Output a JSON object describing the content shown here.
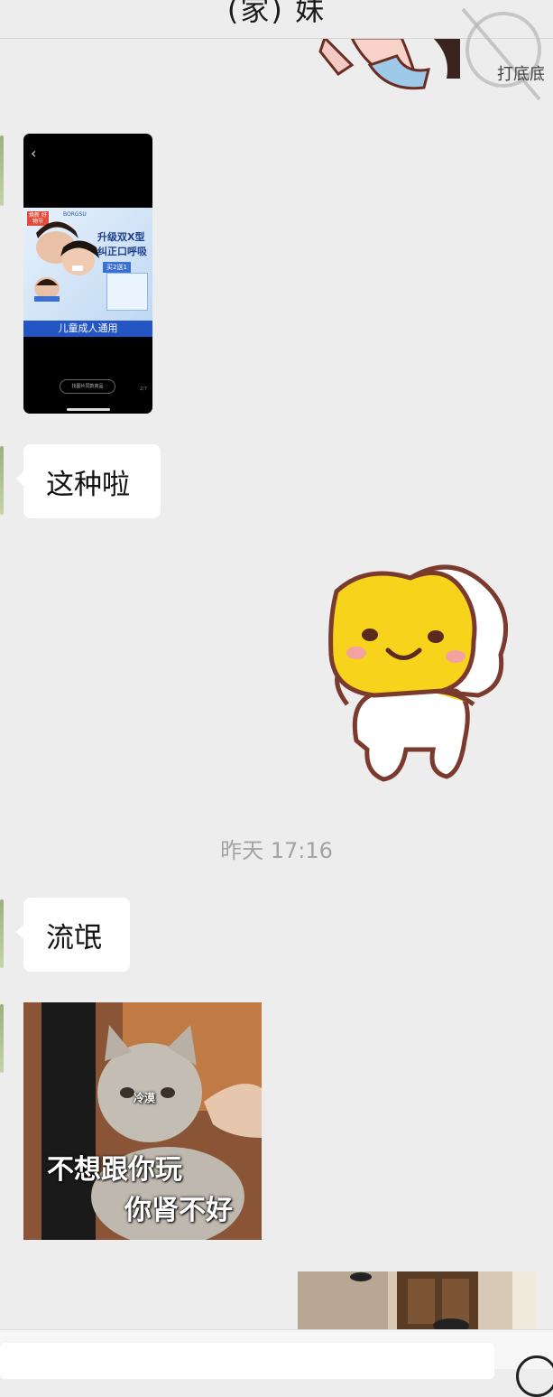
{
  "header": {
    "title": "(家) 妹"
  },
  "watermark": {
    "text": "打底底"
  },
  "phone_screenshot": {
    "back_glyph": "‹",
    "brand": "BORGSU",
    "promo_badge": "焕新 好物节",
    "headline_1": "升级双X型",
    "headline_2": "纠正口呼吸",
    "offer": "买2送1",
    "footer": "儿童成人通用",
    "search_pill": "找图片同款商品",
    "page_indicator": "2/7"
  },
  "messages": [
    {
      "text": "这种啦"
    },
    {
      "text": "流氓"
    }
  ],
  "timestamp": "昨天 17:16",
  "meme": {
    "small_caption": "冷漠",
    "line_1": "不想跟你玩",
    "line_2": "你肾不好"
  },
  "colors": {
    "background": "#ededed",
    "bubble": "#ffffff",
    "timestamp": "#a3a3a3",
    "sticker_yellow": "#f7d31c"
  }
}
